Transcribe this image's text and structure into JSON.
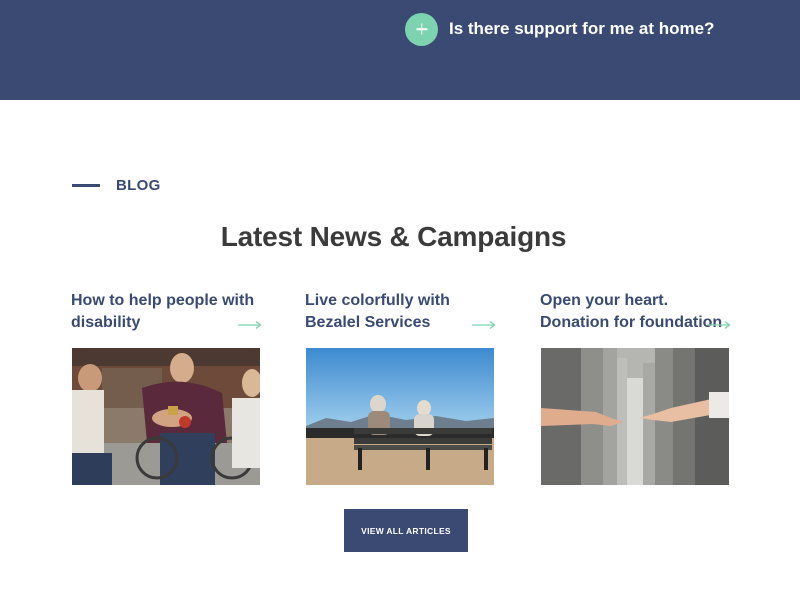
{
  "faq": {
    "question": "Is there support for me at home?",
    "toggle_icon": "plus-icon"
  },
  "blog": {
    "eyebrow": "BLOG",
    "title": "Latest News & Campaigns",
    "articles": [
      {
        "title": "How to help people with disability",
        "image": "friends-with-wheelchair-user-photo",
        "icon": "arrow-right-icon"
      },
      {
        "title": "Live colorfully with Bezalel Services",
        "image": "elderly-couple-on-bench-photo",
        "icon": "arrow-right-icon"
      },
      {
        "title": "Open your heart. Donation for foundation",
        "image": "reaching-hands-photo",
        "icon": "arrow-right-icon"
      }
    ],
    "view_all_label": "VIEW ALL ARTICLES"
  },
  "colors": {
    "navy": "#3a4a73",
    "mint": "#7dd3b0",
    "heading": "#3b3b3b",
    "white": "#ffffff"
  }
}
